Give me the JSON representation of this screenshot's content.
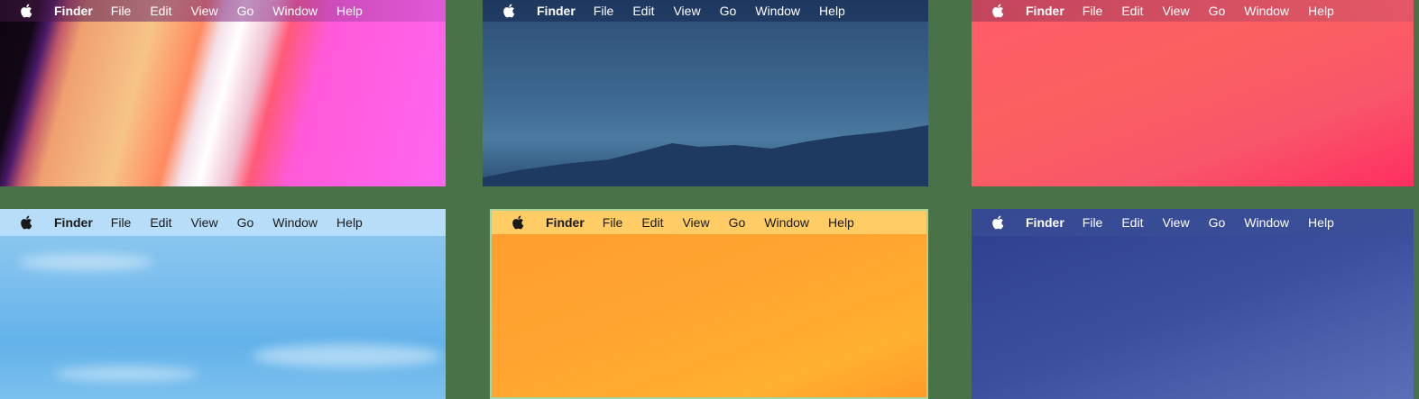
{
  "panels": [
    {
      "menu": {
        "app_name": "Finder",
        "items": [
          "File",
          "Edit",
          "View",
          "Go",
          "Window",
          "Help"
        ]
      }
    },
    {
      "menu": {
        "app_name": "Finder",
        "items": [
          "File",
          "Edit",
          "View",
          "Go",
          "Window",
          "Help"
        ]
      }
    },
    {
      "menu": {
        "app_name": "Finder",
        "items": [
          "File",
          "Edit",
          "View",
          "Go",
          "Window",
          "Help"
        ]
      }
    },
    {
      "menu": {
        "app_name": "Finder",
        "items": [
          "File",
          "Edit",
          "View",
          "Go",
          "Window",
          "Help"
        ]
      }
    },
    {
      "menu": {
        "app_name": "Finder",
        "items": [
          "File",
          "Edit",
          "View",
          "Go",
          "Window",
          "Help"
        ]
      }
    },
    {
      "menu": {
        "app_name": "Finder",
        "items": [
          "File",
          "Edit",
          "View",
          "Go",
          "Window",
          "Help"
        ]
      }
    }
  ],
  "icons": {
    "menu_logo": "apple-icon"
  },
  "colors": {
    "background": "#4a7249",
    "light_text": "#ffffff",
    "dark_text": "#1a1a1a"
  }
}
